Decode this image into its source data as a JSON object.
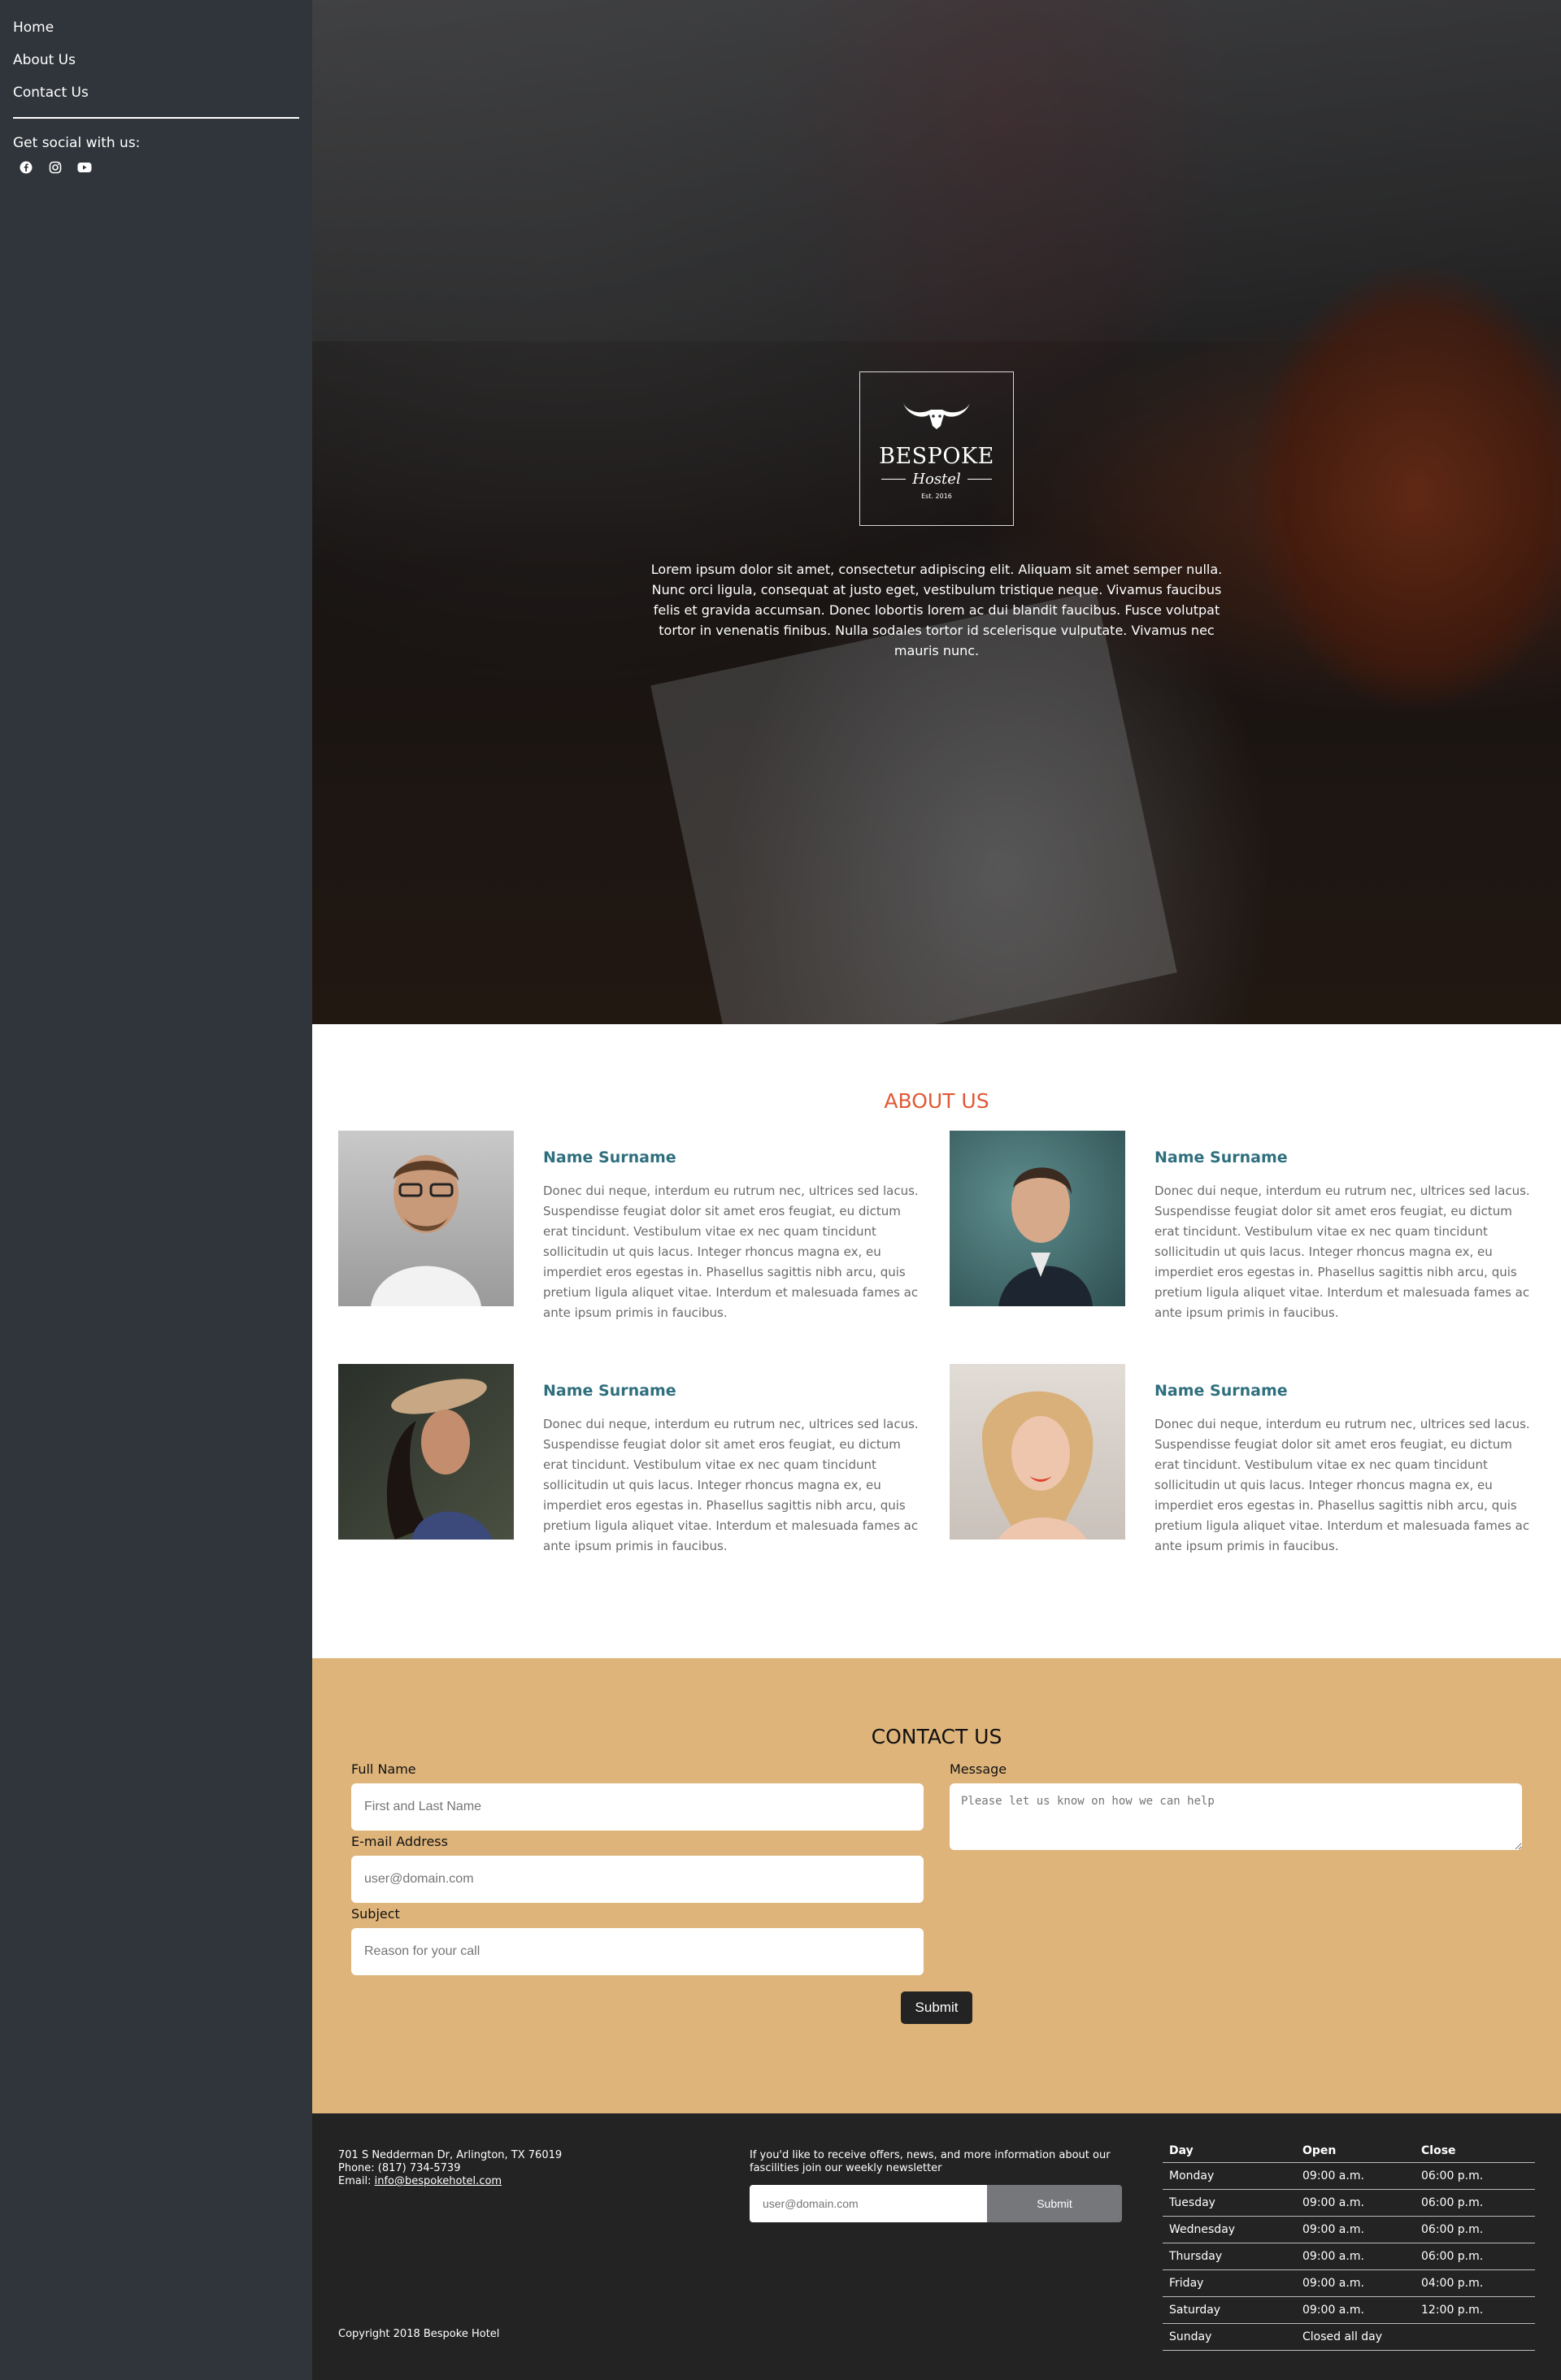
{
  "sidebar": {
    "nav": [
      {
        "label": "Home"
      },
      {
        "label": "About Us"
      },
      {
        "label": "Contact Us"
      }
    ],
    "social_title": "Get social with us:",
    "social_icons": [
      "facebook-icon",
      "instagram-icon",
      "youtube-icon"
    ]
  },
  "hero": {
    "logo": {
      "title": "BESPOKE",
      "subtitle": "Hostel",
      "est": "Est. 2016"
    },
    "text": "Lorem ipsum dolor sit amet, consectetur adipiscing elit. Aliquam sit amet semper nulla. Nunc orci ligula, consequat at justo eget, vestibulum tristique neque. Vivamus faucibus felis et gravida accumsan. Donec lobortis lorem ac dui blandit faucibus. Fusce volutpat tortor in venenatis finibus. Nulla sodales tortor id scelerisque vulputate. Vivamus nec mauris nunc."
  },
  "about": {
    "title": "ABOUT US",
    "people": [
      {
        "name": "Name Surname",
        "bio": "Donec dui neque, interdum eu rutrum nec, ultrices sed lacus. Suspendisse feugiat dolor sit amet eros feugiat, eu dictum erat tincidunt. Vestibulum vitae ex nec quam tincidunt sollicitudin ut quis lacus. Integer rhoncus magna ex, eu imperdiet eros egestas in. Phasellus sagittis nibh arcu, quis pretium ligula aliquet vitae. Interdum et malesuada fames ac ante ipsum primis in faucibus."
      },
      {
        "name": "Name Surname",
        "bio": "Donec dui neque, interdum eu rutrum nec, ultrices sed lacus. Suspendisse feugiat dolor sit amet eros feugiat, eu dictum erat tincidunt. Vestibulum vitae ex nec quam tincidunt sollicitudin ut quis lacus. Integer rhoncus magna ex, eu imperdiet eros egestas in. Phasellus sagittis nibh arcu, quis pretium ligula aliquet vitae. Interdum et malesuada fames ac ante ipsum primis in faucibus."
      },
      {
        "name": "Name Surname",
        "bio": "Donec dui neque, interdum eu rutrum nec, ultrices sed lacus. Suspendisse feugiat dolor sit amet eros feugiat, eu dictum erat tincidunt. Vestibulum vitae ex nec quam tincidunt sollicitudin ut quis lacus. Integer rhoncus magna ex, eu imperdiet eros egestas in. Phasellus sagittis nibh arcu, quis pretium ligula aliquet vitae. Interdum et malesuada fames ac ante ipsum primis in faucibus."
      },
      {
        "name": "Name Surname",
        "bio": "Donec dui neque, interdum eu rutrum nec, ultrices sed lacus. Suspendisse feugiat dolor sit amet eros feugiat, eu dictum erat tincidunt. Vestibulum vitae ex nec quam tincidunt sollicitudin ut quis lacus. Integer rhoncus magna ex, eu imperdiet eros egestas in. Phasellus sagittis nibh arcu, quis pretium ligula aliquet vitae. Interdum et malesuada fames ac ante ipsum primis in faucibus."
      }
    ]
  },
  "contact": {
    "title": "CONTACT US",
    "full_name": {
      "label": "Full Name",
      "placeholder": "First and Last Name",
      "value": ""
    },
    "email": {
      "label": "E-mail Address",
      "placeholder": "user@domain.com",
      "value": ""
    },
    "subject": {
      "label": "Subject",
      "placeholder": "Reason for your call",
      "value": ""
    },
    "message": {
      "label": "Message",
      "placeholder": "Please let us know on how we can help",
      "value": ""
    },
    "submit_label": "Submit"
  },
  "footer": {
    "address_line": "701 S Nedderman Dr, Arlington, TX 76019",
    "phone_line": "Phone: (817) 734-5739",
    "email_label": "Email: ",
    "email": "info@bespokehotel.com",
    "copyright": "Copyright 2018 Bespoke Hotel",
    "newsletter": {
      "text": "If you'd like to receive offers, news, and more information about our fascilities join our weekly newsletter",
      "placeholder": "user@domain.com",
      "button": "Submit"
    },
    "hours": {
      "headers": [
        "Day",
        "Open",
        "Close"
      ],
      "rows": [
        {
          "day": "Monday",
          "open": "09:00 a.m.",
          "close": "06:00 p.m."
        },
        {
          "day": "Tuesday",
          "open": "09:00 a.m.",
          "close": "06:00 p.m."
        },
        {
          "day": "Wednesday",
          "open": "09:00 a.m.",
          "close": "06:00 p.m."
        },
        {
          "day": "Thursday",
          "open": "09:00 a.m.",
          "close": "06:00 p.m."
        },
        {
          "day": "Friday",
          "open": "09:00 a.m.",
          "close": "04:00 p.m."
        },
        {
          "day": "Saturday",
          "open": "09:00 a.m.",
          "close": "12:00 p.m."
        },
        {
          "day": "Sunday",
          "open": "Closed all day",
          "close": ""
        }
      ]
    }
  },
  "colors": {
    "sidebar_bg": "#30353b",
    "accent_orange": "#e05a36",
    "name_teal": "#2f6f7d",
    "contact_bg": "#deb47b",
    "footer_bg": "#232323"
  }
}
